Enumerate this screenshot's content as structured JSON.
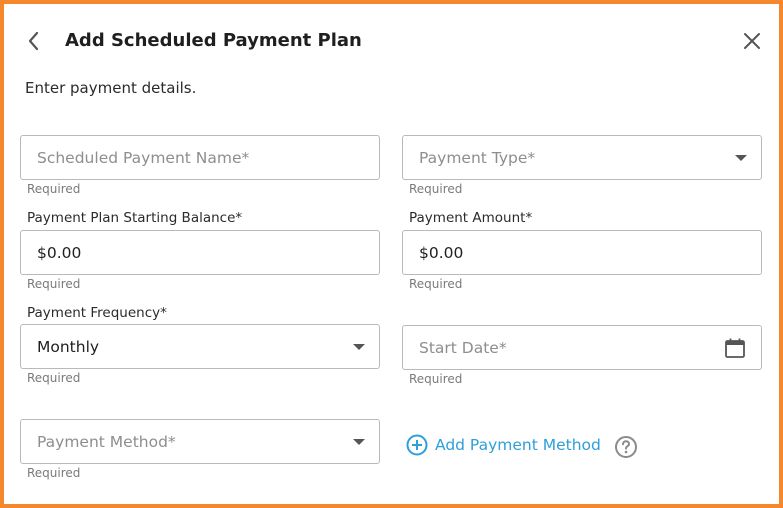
{
  "header": {
    "title": "Add Scheduled Payment Plan",
    "back_icon": "chevron-left-icon",
    "close_icon": "close-icon"
  },
  "subtitle": "Enter payment details.",
  "fields": {
    "scheduled_payment_name": {
      "placeholder": "Scheduled Payment Name*",
      "helper": "Required"
    },
    "payment_type": {
      "placeholder": "Payment Type*",
      "helper": "Required"
    },
    "starting_balance": {
      "label": "Payment Plan Starting Balance*",
      "value": "$0.00",
      "helper": "Required"
    },
    "payment_amount": {
      "label": "Payment Amount*",
      "value": "$0.00",
      "helper": "Required"
    },
    "payment_frequency": {
      "label": "Payment Frequency*",
      "value": "Monthly",
      "helper": "Required"
    },
    "start_date": {
      "placeholder": "Start Date*",
      "helper": "Required",
      "icon": "calendar-icon"
    },
    "payment_method": {
      "placeholder": "Payment Method*",
      "helper": "Required"
    }
  },
  "add_payment_method": {
    "label": "Add Payment Method",
    "icon": "plus-circle-icon"
  },
  "help_icon": "help-circle-icon",
  "colors": {
    "frame_border": "#f5872c",
    "accent": "#2e9fd9",
    "field_border": "#b9b9b9",
    "placeholder": "#8e8e8e",
    "helper_text": "#7a7a7a"
  }
}
